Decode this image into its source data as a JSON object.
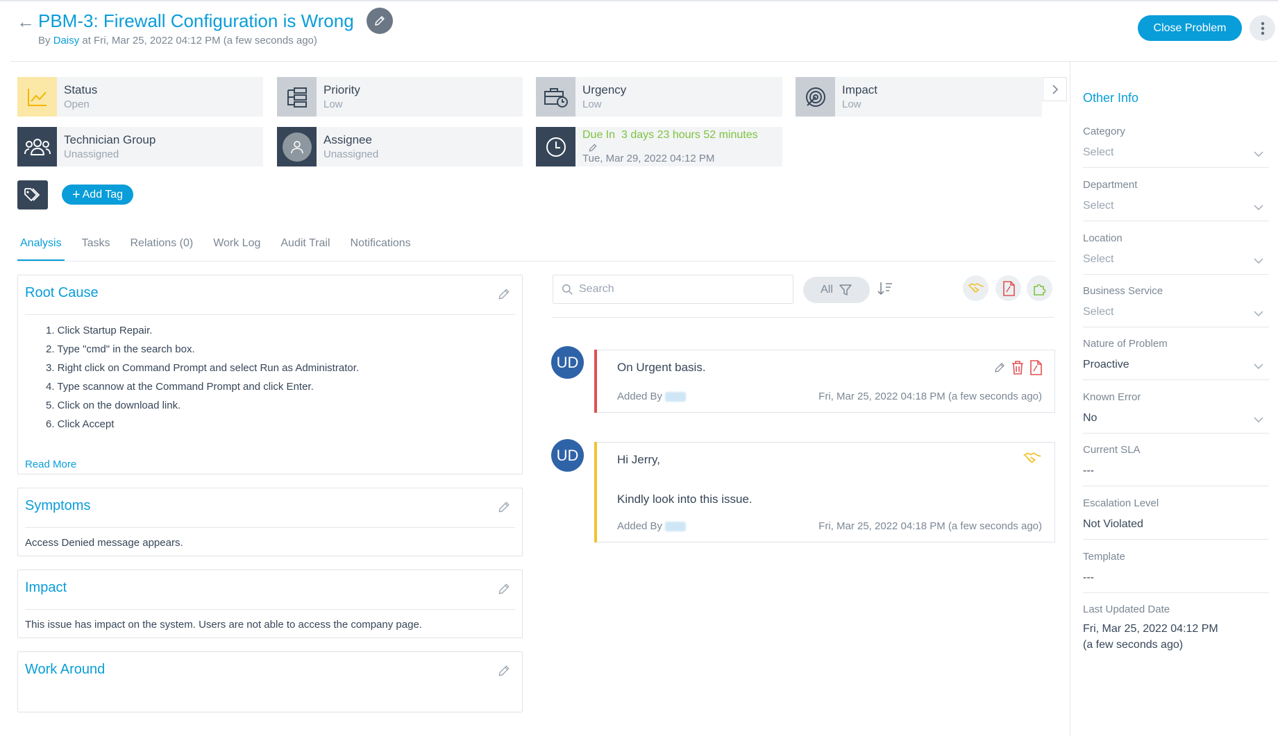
{
  "header": {
    "title": "PBM-3: Firewall Configuration is Wrong",
    "by_prefix": "By",
    "author": "Daisy",
    "created_text": "at Fri, Mar 25, 2022 04:12 PM (a few seconds ago)",
    "close_button": "Close Problem"
  },
  "cards": {
    "status": {
      "label": "Status",
      "value": "Open"
    },
    "priority": {
      "label": "Priority",
      "value": "Low"
    },
    "urgency": {
      "label": "Urgency",
      "value": "Low"
    },
    "impact": {
      "label": "Impact",
      "value": "Low"
    },
    "technician_group": {
      "label": "Technician Group",
      "value": "Unassigned"
    },
    "assignee": {
      "label": "Assignee",
      "value": "Unassigned"
    },
    "due": {
      "label": "Due In",
      "remaining": "3 days 23 hours 52 minutes",
      "date": "Tue, Mar 29, 2022 04:12 PM"
    }
  },
  "add_tag": "Add Tag",
  "tabs": [
    "Analysis",
    "Tasks",
    "Relations (0)",
    "Work Log",
    "Audit Trail",
    "Notifications"
  ],
  "analysis": {
    "root_cause": {
      "title": "Root Cause",
      "steps": [
        "1. Click Startup Repair.",
        "2. Type \"cmd\" in the search box.",
        "3. Right click on Command Prompt and select Run as Administrator.",
        "4. Type scannow at the Command Prompt and click Enter.",
        "5. Click on the download link.",
        "6. Click Accept"
      ],
      "read_more": "Read More"
    },
    "symptoms": {
      "title": "Symptoms",
      "text": "Access Denied message appears."
    },
    "impact": {
      "title": "Impact",
      "text": "This issue has impact on the system. Users are not able to access the company page."
    },
    "work_around": {
      "title": "Work Around",
      "text": ""
    }
  },
  "worklog": {
    "search_placeholder": "Search",
    "filter_label": "All",
    "entries": [
      {
        "initials": "UD",
        "message": "On Urgent basis.",
        "added_by": "Added By",
        "timestamp": "Fri, Mar 25, 2022 04:18 PM (a few seconds ago)",
        "accent": "#e05050"
      },
      {
        "initials": "UD",
        "line1": "Hi Jerry,",
        "line2": "Kindly look into this issue.",
        "added_by": "Added By",
        "timestamp": "Fri, Mar 25, 2022 04:18 PM (a few seconds ago)",
        "accent": "#f2c230"
      }
    ]
  },
  "other_info": {
    "title": "Other Info",
    "category": {
      "label": "Category",
      "value": "Select"
    },
    "department": {
      "label": "Department",
      "value": "Select"
    },
    "location": {
      "label": "Location",
      "value": "Select"
    },
    "business_service": {
      "label": "Business Service",
      "value": "Select"
    },
    "nature": {
      "label": "Nature of Problem",
      "value": "Proactive"
    },
    "known_error": {
      "label": "Known Error",
      "value": "No"
    },
    "current_sla": {
      "label": "Current SLA",
      "value": "---"
    },
    "escalation": {
      "label": "Escalation Level",
      "value": "Not Violated"
    },
    "template": {
      "label": "Template",
      "value": "---"
    },
    "last_updated": {
      "label": "Last Updated Date",
      "value": "Fri, Mar 25, 2022 04:12 PM",
      "relative": "(a few seconds ago)"
    }
  },
  "colors": {
    "accent": "#099dd9",
    "dark": "#364658",
    "status_yellow": "#f5c744",
    "due_green": "#7cc33e"
  }
}
